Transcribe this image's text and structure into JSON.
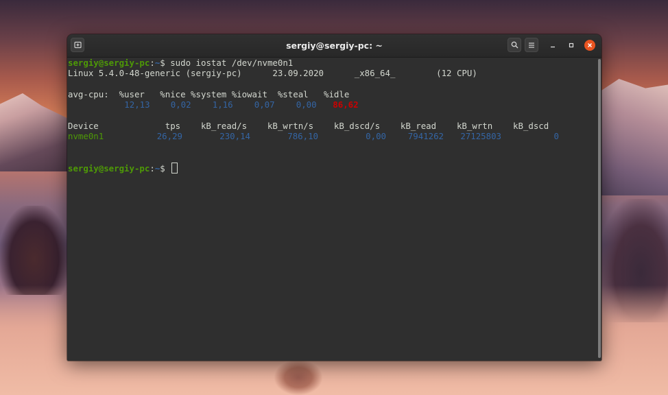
{
  "window": {
    "title": "sergiy@sergiy-pc: ~"
  },
  "icons": {
    "new_tab": "new-tab-icon",
    "search": "search-icon",
    "menu": "hamburger-menu-icon",
    "minimize": "minimize-icon",
    "maximize": "maximize-icon",
    "close": "close-icon"
  },
  "colors": {
    "prompt_user": "#4e9a06",
    "prompt_path": "#3465a4",
    "value_blue": "#3465a4",
    "idle_red": "#cc0000",
    "close_button": "#e95420",
    "terminal_bg": "#2f2f2f"
  },
  "terminal": {
    "prompt1": {
      "user_host": "sergiy@sergiy-pc",
      "colon": ":",
      "path": "~",
      "symbol": "$",
      "command": " sudo iostat /dev/nvme0n1"
    },
    "sysinfo": "Linux 5.4.0-48-generic (sergiy-pc)      23.09.2020      _x86_64_        (12 CPU)",
    "cpu_header": "avg-cpu:  %user   %nice %system %iowait  %steal   %idle",
    "cpu_values": {
      "indent": "          ",
      "user": "12,13",
      "nice": "0,02",
      "system": "1,16",
      "iowait": "0,07",
      "steal": "0,00",
      "idle": "86,62"
    },
    "device_header": "Device             tps    kB_read/s    kB_wrtn/s    kB_dscd/s    kB_read    kB_wrtn    kB_dscd",
    "device_row": {
      "device": "nvme0n1",
      "tps": "26,29",
      "kb_read_s": "230,14",
      "kb_wrtn_s": "786,10",
      "kb_dscd_s": "0,00",
      "kb_read": "7941262",
      "kb_wrtn": "27125803",
      "kb_dscd": "0"
    },
    "prompt2": {
      "user_host": "sergiy@sergiy-pc",
      "colon": ":",
      "path": "~",
      "symbol": "$ "
    }
  }
}
